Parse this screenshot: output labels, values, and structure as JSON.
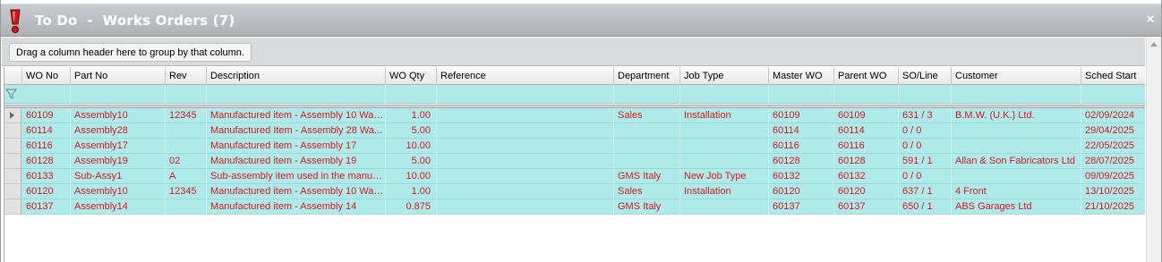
{
  "window": {
    "title": "To Do  -  Works Orders (7)",
    "close_glyph": "×",
    "icon": "exclamation-icon"
  },
  "group_panel": {
    "hint": "Drag a column header here to group by that column."
  },
  "columns": [
    "WO No",
    "Part No",
    "Rev",
    "Description",
    "WO Qty",
    "Reference",
    "Department",
    "Job Type",
    "Master WO",
    "Parent WO",
    "SO/Line",
    "Customer",
    "Sched Start"
  ],
  "rows": [
    [
      "60109",
      "Assembly10",
      "12345",
      "Manufactured item - Assembly 10 Way...",
      "1.00",
      "",
      "Sales",
      "Installation",
      "60109",
      "60109",
      "631 / 3",
      "B.M.W. (U.K.) Ltd.",
      "02/09/2024"
    ],
    [
      "60114",
      "Assembly28",
      "",
      "Manufactured Item - Assembly 28 Wa...",
      "5.00",
      "",
      "",
      "",
      "60114",
      "60114",
      "0 / 0",
      "",
      "29/04/2025"
    ],
    [
      "60116",
      "Assembly17",
      "",
      "Manufactured item - Assembly 17",
      "10.00",
      "",
      "",
      "",
      "60116",
      "60116",
      "0 / 0",
      "",
      "22/05/2025"
    ],
    [
      "60128",
      "Assembly19",
      "02",
      "Manufactured item - Assembly 19",
      "5.00",
      "",
      "",
      "",
      "60128",
      "60128",
      "591 / 1",
      "Allan & Son Fabricators Ltd",
      "28/07/2025"
    ],
    [
      "60133",
      "Sub-Assy1",
      "A",
      "Sub-assembly item used in the manufa...",
      "10.00",
      "",
      "GMS Italy",
      "New Job Type",
      "60132",
      "60132",
      "0 / 0",
      "",
      "09/09/2025"
    ],
    [
      "60120",
      "Assembly10",
      "12345",
      "Manufactured item - Assembly 10 Way...",
      "1.00",
      "",
      "Sales",
      "Installation",
      "60120",
      "60120",
      "637 / 1",
      "4 Front",
      "13/10/2025"
    ],
    [
      "60137",
      "Assembly14",
      "",
      "Manufactured item - Assembly 14",
      "0.875",
      "",
      "GMS Italy",
      "",
      "60137",
      "60137",
      "650 / 1",
      "ABS Garages Ltd",
      "21/10/2025"
    ]
  ],
  "colors": {
    "row_background": "#aeeaea",
    "row_text": "#d41a1a",
    "title_bar": "#b5b9bd"
  }
}
